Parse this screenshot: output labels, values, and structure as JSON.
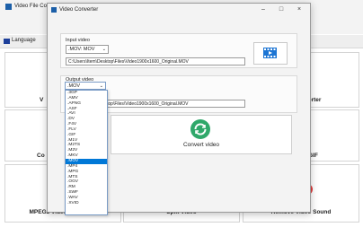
{
  "app": {
    "title": "Video File Conver",
    "menu_language": "Language"
  },
  "tiles": {
    "partial_top_left": "V",
    "partial_top_right": "erter",
    "partial_mid_left": "Co",
    "partial_mid_right": "GIF",
    "mpeg2": "MPEG2 Video Extension",
    "split": "Split Video",
    "remove_sound": "Remove Video Sound"
  },
  "dialog": {
    "title": "Video Converter",
    "input_label": "Input video",
    "input_type": ".MOV: MOV",
    "input_path": "C:\\Users\\Item\\Desktop\\Files\\Video1900x1600_Original.MOV",
    "output_label": "Output video",
    "output_type": ".MOV",
    "output_path_visible": "top\\Files\\Video1900x1600_Original.MOV",
    "convert_label": "Convert video"
  },
  "dropdown": {
    "options": [
      ".3GP",
      ".AMV",
      ".APNG",
      ".ASF",
      ".AVI",
      ".DV",
      ".F4V",
      ".FLV",
      ".GIF",
      ".M1V",
      ".M2TS",
      ".M2V",
      ".MKV",
      ".MOV",
      ".MP4",
      ".MPG",
      ".MTS",
      ".OGV",
      ".RM",
      ".SWF",
      ".WAV",
      ".XVID"
    ],
    "selected": ".MOV"
  },
  "colors": {
    "accent": "#0078d7",
    "icon_green": "#2fa86a",
    "icon_blue": "#1c75d4",
    "icon_red": "#e23d3d"
  }
}
